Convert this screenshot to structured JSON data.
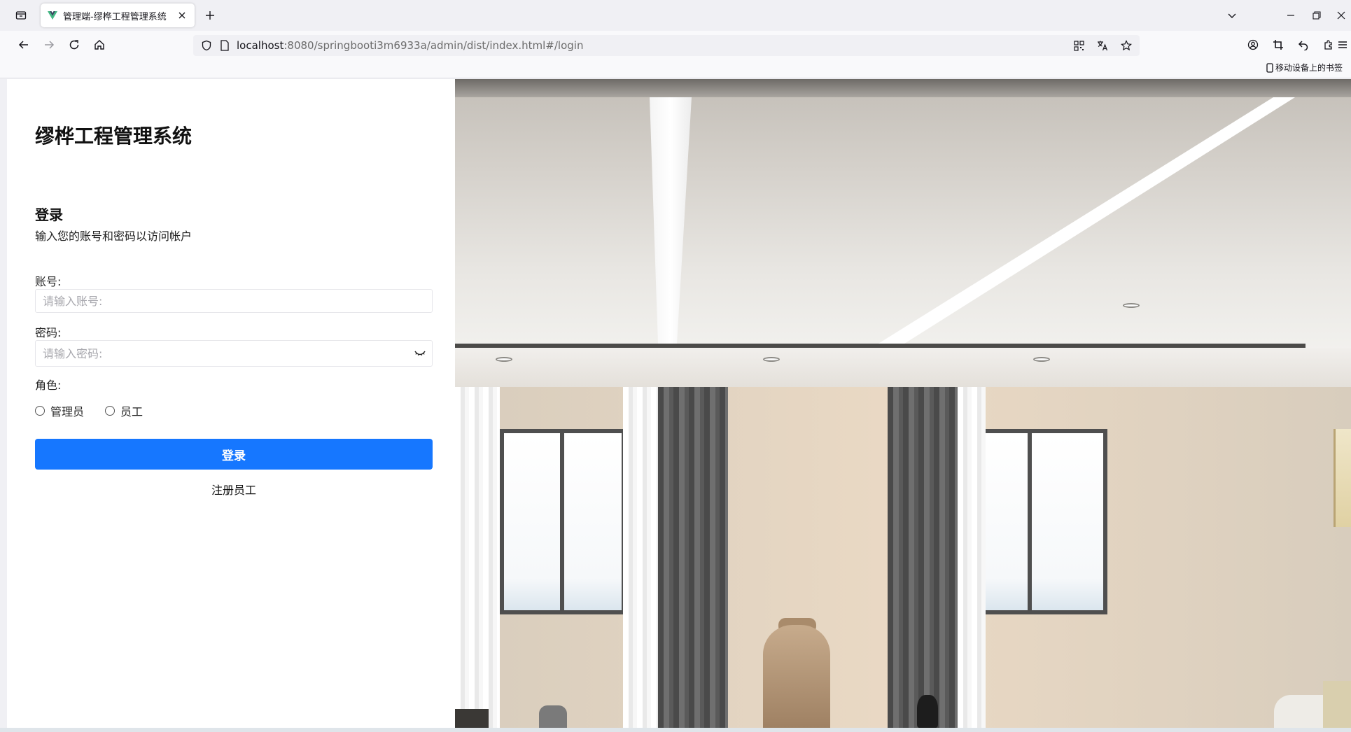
{
  "browser": {
    "tab": {
      "title": "管理端-缪桦工程管理系统"
    },
    "url": {
      "host": "localhost",
      "path": ":8080/springbooti3m6933a/admin/dist/index.html#/login"
    },
    "bookmarks": {
      "mobile_label": "移动设备上的书签"
    },
    "icons": [
      "tab-list-icon",
      "vue-favicon-icon",
      "close-icon",
      "new-tab-icon",
      "chevron-down-icon",
      "minimize-icon",
      "restore-icon",
      "window-close-icon",
      "back-icon",
      "forward-icon",
      "reload-icon",
      "home-icon",
      "shield-icon",
      "page-icon",
      "qr-code-icon",
      "translate-icon",
      "bookmark-star-icon",
      "account-icon",
      "crop-icon",
      "undo-icon",
      "extensions-icon",
      "menu-icon",
      "mobile-device-icon"
    ]
  },
  "login": {
    "system_title": "缪桦工程管理系统",
    "heading": "登录",
    "subtitle": "输入您的账号和密码以访问帐户",
    "account": {
      "label": "账号:",
      "placeholder": "请输入账号:",
      "value": ""
    },
    "password": {
      "label": "密码:",
      "placeholder": "请输入密码:",
      "value": ""
    },
    "role": {
      "label": "角色:",
      "options": [
        "管理员",
        "员工"
      ],
      "selected": null
    },
    "submit_label": "登录",
    "register_label": "注册员工"
  },
  "colors": {
    "primary": "#1677ff",
    "browser_chrome": "#f0f0f4",
    "text": "#222222"
  }
}
